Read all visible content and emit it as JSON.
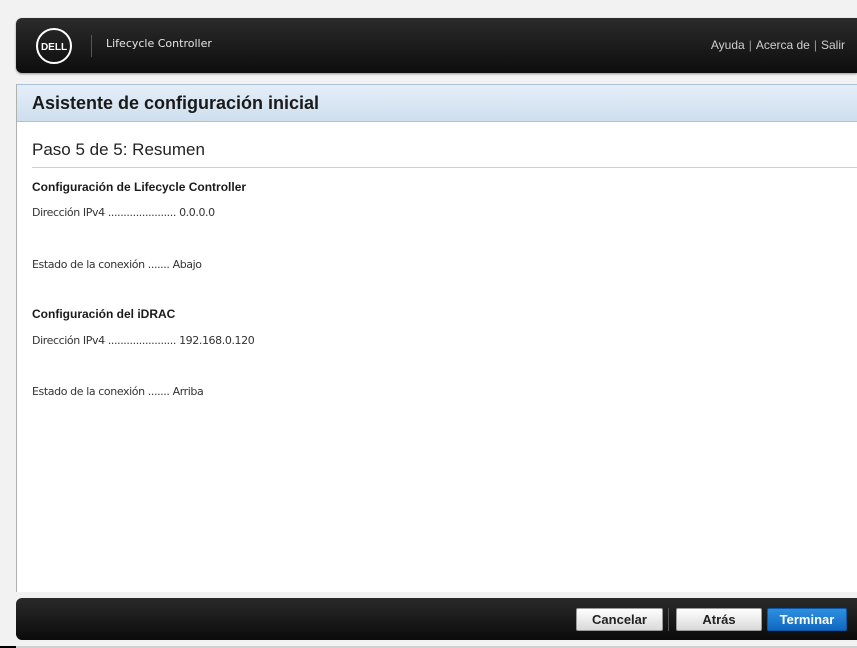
{
  "header": {
    "logo_text": "DELL",
    "app_title": "Lifecycle Controller",
    "links": [
      "Ayuda",
      "Acerca de",
      "Salir"
    ]
  },
  "wizard": {
    "title": "Asistente de configuración inicial",
    "step": "Paso 5 de 5: Resumen"
  },
  "sections": [
    {
      "title": "Configuración de Lifecycle Controller",
      "fields": [
        {
          "label": "Dirección IPv4",
          "dots": "......................",
          "value": "0.0.0.0"
        },
        {
          "label": "Estado de la conexión",
          "dots": ".......",
          "value": "Abajo"
        }
      ]
    },
    {
      "title": "Configuración del iDRAC",
      "fields": [
        {
          "label": "Dirección IPv4",
          "dots": "......................",
          "value": "192.168.0.120"
        },
        {
          "label": "Estado de la conexión",
          "dots": ".......",
          "value": "Arriba"
        }
      ]
    }
  ],
  "footer": {
    "cancel_label": "Cancelar",
    "back_label": "Atrás",
    "finish_label": "Terminar"
  },
  "colors": {
    "header_bg": "#1a1a1a",
    "wizard_header_bg": "#d9e6f3",
    "primary_button": "#1a78d0"
  }
}
